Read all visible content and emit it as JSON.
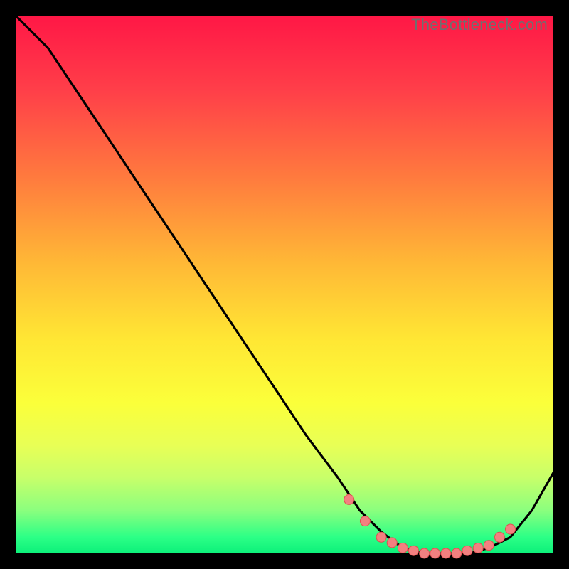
{
  "watermark": "TheBottleneck.com",
  "colors": {
    "line": "#000000",
    "marker_fill": "#f28080",
    "marker_stroke": "#e05050"
  },
  "chart_data": {
    "type": "line",
    "title": "",
    "xlabel": "",
    "ylabel": "",
    "xlim": [
      0,
      100
    ],
    "ylim": [
      0,
      100
    ],
    "series": [
      {
        "name": "curve",
        "x": [
          0,
          6,
          12,
          18,
          24,
          30,
          36,
          42,
          48,
          54,
          60,
          64,
          68,
          72,
          76,
          80,
          84,
          88,
          92,
          96,
          100
        ],
        "y": [
          100,
          94,
          85,
          76,
          67,
          58,
          49,
          40,
          31,
          22,
          14,
          8,
          4,
          1,
          0,
          0,
          0,
          1,
          3,
          8,
          15
        ]
      }
    ],
    "markers": {
      "x": [
        62,
        65,
        68,
        70,
        72,
        74,
        76,
        78,
        80,
        82,
        84,
        86,
        88,
        90,
        92
      ],
      "y": [
        10,
        6,
        3,
        2,
        1,
        0.5,
        0,
        0,
        0,
        0,
        0.5,
        1,
        1.5,
        3,
        4.5
      ]
    }
  }
}
